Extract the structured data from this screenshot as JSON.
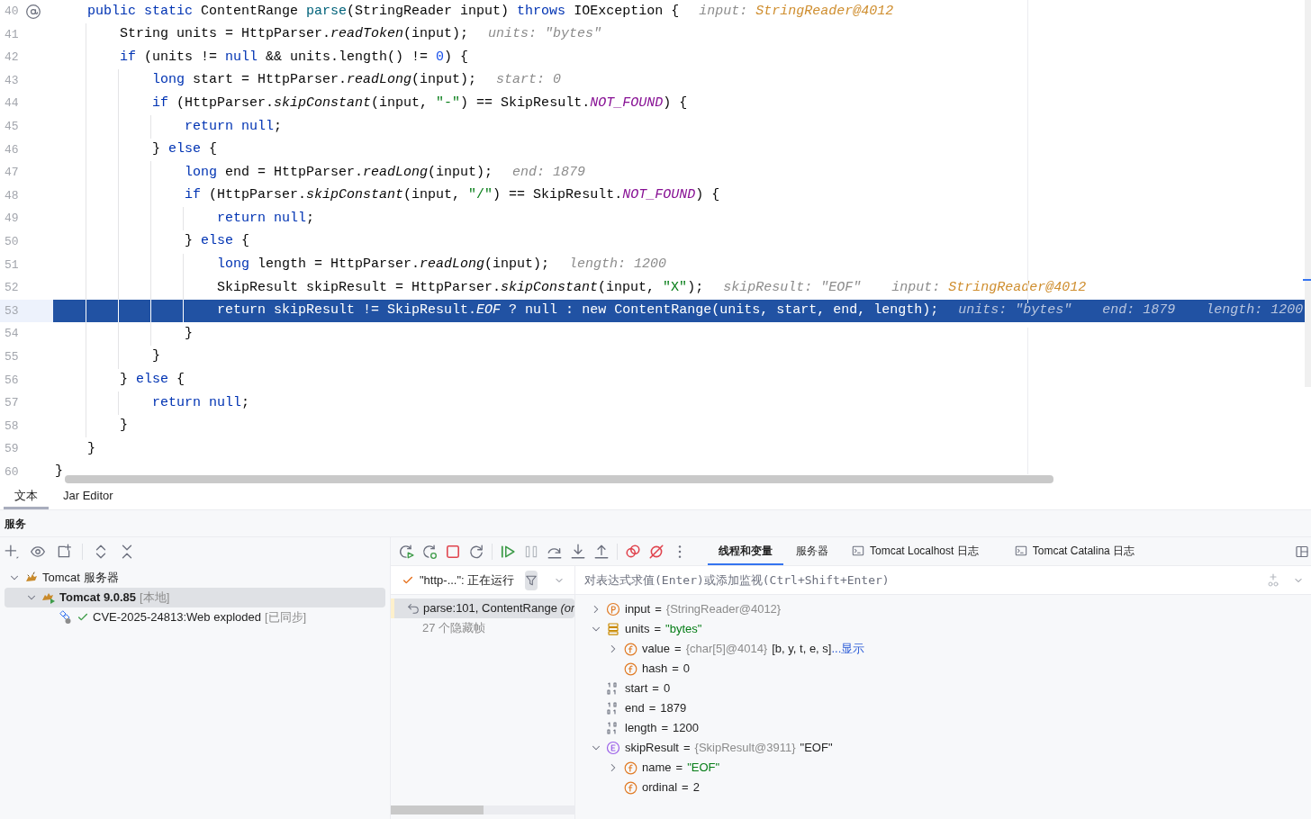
{
  "editor": {
    "lines": [
      {
        "number": "40",
        "marker": true,
        "selected": false,
        "tokens": [
          {
            "t": "    public static ",
            "kind": "kw"
          },
          {
            "t": "ContentRange ",
            "kind": "plain"
          },
          {
            "t": "parse",
            "kind": "decl"
          },
          {
            "t": "(StringReader input) ",
            "kind": "plain"
          },
          {
            "t": "throws ",
            "kind": "kw"
          },
          {
            "t": "IOException {",
            "kind": "plain"
          }
        ],
        "hints": [
          {
            "label": "input:",
            "value": "StringReader@4012",
            "kind": "ref"
          }
        ]
      },
      {
        "number": "41",
        "selected": false,
        "tokens": [
          {
            "t": "        String units = HttpParser.",
            "kind": "plain"
          },
          {
            "t": "readToken",
            "kind": "call"
          },
          {
            "t": "(input);",
            "kind": "plain"
          }
        ],
        "hints": [
          {
            "label": "units:",
            "value": "\"bytes\"",
            "kind": "plain"
          }
        ]
      },
      {
        "number": "42",
        "selected": false,
        "tokens": [
          {
            "t": "        if ",
            "kind": "kw"
          },
          {
            "t": "(units != ",
            "kind": "plain"
          },
          {
            "t": "null ",
            "kind": "kw"
          },
          {
            "t": "&& units.length() != ",
            "kind": "plain"
          },
          {
            "t": "0",
            "kind": "num"
          },
          {
            "t": ") {",
            "kind": "plain"
          }
        ]
      },
      {
        "number": "43",
        "selected": false,
        "tokens": [
          {
            "t": "            long ",
            "kind": "kw"
          },
          {
            "t": "start = HttpParser.",
            "kind": "plain"
          },
          {
            "t": "readLong",
            "kind": "call"
          },
          {
            "t": "(input);",
            "kind": "plain"
          }
        ],
        "hints": [
          {
            "label": "start:",
            "value": "0",
            "kind": "plain"
          }
        ]
      },
      {
        "number": "44",
        "selected": false,
        "tokens": [
          {
            "t": "            if ",
            "kind": "kw"
          },
          {
            "t": "(HttpParser.",
            "kind": "plain"
          },
          {
            "t": "skipConstant",
            "kind": "call"
          },
          {
            "t": "(input, ",
            "kind": "plain"
          },
          {
            "t": "\"-\"",
            "kind": "str"
          },
          {
            "t": ") == SkipResult.",
            "kind": "plain"
          },
          {
            "t": "NOT_FOUND",
            "kind": "const"
          },
          {
            "t": ") {",
            "kind": "plain"
          }
        ]
      },
      {
        "number": "45",
        "selected": false,
        "tokens": [
          {
            "t": "                return null",
            "kind": "kw"
          },
          {
            "t": ";",
            "kind": "plain"
          }
        ]
      },
      {
        "number": "46",
        "selected": false,
        "tokens": [
          {
            "t": "            } ",
            "kind": "plain"
          },
          {
            "t": "else ",
            "kind": "kw"
          },
          {
            "t": "{",
            "kind": "plain"
          }
        ]
      },
      {
        "number": "47",
        "selected": false,
        "tokens": [
          {
            "t": "                long ",
            "kind": "kw"
          },
          {
            "t": "end = HttpParser.",
            "kind": "plain"
          },
          {
            "t": "readLong",
            "kind": "call"
          },
          {
            "t": "(input);",
            "kind": "plain"
          }
        ],
        "hints": [
          {
            "label": "end:",
            "value": "1879",
            "kind": "plain"
          }
        ]
      },
      {
        "number": "48",
        "selected": false,
        "tokens": [
          {
            "t": "                if ",
            "kind": "kw"
          },
          {
            "t": "(HttpParser.",
            "kind": "plain"
          },
          {
            "t": "skipConstant",
            "kind": "call"
          },
          {
            "t": "(input, ",
            "kind": "plain"
          },
          {
            "t": "\"/\"",
            "kind": "str"
          },
          {
            "t": ") == SkipResult.",
            "kind": "plain"
          },
          {
            "t": "NOT_FOUND",
            "kind": "const"
          },
          {
            "t": ") {",
            "kind": "plain"
          }
        ]
      },
      {
        "number": "49",
        "selected": false,
        "tokens": [
          {
            "t": "                    return null",
            "kind": "kw"
          },
          {
            "t": ";",
            "kind": "plain"
          }
        ]
      },
      {
        "number": "50",
        "selected": false,
        "tokens": [
          {
            "t": "                } ",
            "kind": "plain"
          },
          {
            "t": "else ",
            "kind": "kw"
          },
          {
            "t": "{",
            "kind": "plain"
          }
        ]
      },
      {
        "number": "51",
        "selected": false,
        "tokens": [
          {
            "t": "                    long ",
            "kind": "kw"
          },
          {
            "t": "length = HttpParser.",
            "kind": "plain"
          },
          {
            "t": "readLong",
            "kind": "call"
          },
          {
            "t": "(input);",
            "kind": "plain"
          }
        ],
        "hints": [
          {
            "label": "length:",
            "value": "1200",
            "kind": "plain"
          }
        ]
      },
      {
        "number": "52",
        "selected": false,
        "tokens": [
          {
            "t": "                    SkipResult skipResult = HttpParser.",
            "kind": "plain"
          },
          {
            "t": "skipConstant",
            "kind": "call"
          },
          {
            "t": "(input, ",
            "kind": "plain"
          },
          {
            "t": "\"X\"",
            "kind": "str"
          },
          {
            "t": ");",
            "kind": "plain"
          }
        ],
        "hints": [
          {
            "label": "skipResult:",
            "value": "\"EOF\"",
            "kind": "plain"
          },
          {
            "label": "input:",
            "value": "StringReader@4012",
            "kind": "ref"
          }
        ]
      },
      {
        "number": "53",
        "selected": true,
        "tokens": [
          {
            "t": "                    return ",
            "kind": "kw"
          },
          {
            "t": "skipResult != SkipResult.",
            "kind": "plain"
          },
          {
            "t": "EOF",
            "kind": "const"
          },
          {
            "t": " ? ",
            "kind": "plain"
          },
          {
            "t": "null ",
            "kind": "kw"
          },
          {
            "t": ": ",
            "kind": "plain"
          },
          {
            "t": "new ",
            "kind": "kw"
          },
          {
            "t": "ContentRange(units, start, end, length);",
            "kind": "plain"
          }
        ],
        "hints": [
          {
            "label": "units:",
            "value": "\"bytes\"",
            "kind": "plain"
          },
          {
            "label": "end:",
            "value": "1879",
            "kind": "plain"
          },
          {
            "label": "length:",
            "value": "1200",
            "kind": "plain"
          }
        ]
      },
      {
        "number": "54",
        "selected": false,
        "tokens": [
          {
            "t": "                }",
            "kind": "plain"
          }
        ]
      },
      {
        "number": "55",
        "selected": false,
        "tokens": [
          {
            "t": "            }",
            "kind": "plain"
          }
        ]
      },
      {
        "number": "56",
        "selected": false,
        "tokens": [
          {
            "t": "        } ",
            "kind": "plain"
          },
          {
            "t": "else ",
            "kind": "kw"
          },
          {
            "t": "{",
            "kind": "plain"
          }
        ]
      },
      {
        "number": "57",
        "selected": false,
        "tokens": [
          {
            "t": "            return null",
            "kind": "kw"
          },
          {
            "t": ";",
            "kind": "plain"
          }
        ]
      },
      {
        "number": "58",
        "selected": false,
        "tokens": [
          {
            "t": "        }",
            "kind": "plain"
          }
        ]
      },
      {
        "number": "59",
        "selected": false,
        "tokens": [
          {
            "t": "    }",
            "kind": "plain"
          }
        ]
      },
      {
        "number": "60",
        "selected": false,
        "tokens": [
          {
            "t": "}",
            "kind": "plain"
          }
        ]
      }
    ]
  },
  "editor_tabs": [
    {
      "label": "文本",
      "selected": true
    },
    {
      "label": "Jar Editor",
      "selected": false
    }
  ],
  "services": {
    "title": "服务",
    "tree": [
      {
        "label": "Tomcat 服务器",
        "kind": "group",
        "expanded": true,
        "selected": false,
        "children": [
          {
            "label": "Tomcat 9.0.85",
            "note": "[本地]",
            "kind": "server",
            "expanded": true,
            "selected": true,
            "children": [
              {
                "label": "CVE-2025-24813:Web exploded",
                "note": "[已同步]",
                "kind": "artifact",
                "selected": false
              }
            ]
          }
        ]
      }
    ]
  },
  "debugger": {
    "tabs": [
      {
        "label": "线程和变量",
        "kind": "view",
        "selected": true
      },
      {
        "label": "服务器",
        "kind": "view",
        "selected": false
      },
      {
        "label": "Tomcat Localhost 日志",
        "kind": "log",
        "selected": false
      },
      {
        "label": "Tomcat Catalina 日志",
        "kind": "log",
        "selected": false
      }
    ],
    "thread": "\"http-...\": 正在运行",
    "frames": [
      {
        "label": "parse:101, ContentRange",
        "detail": "(or",
        "selected": true
      }
    ],
    "hidden_frames": "27 个隐藏帧",
    "eval_placeholder": "对表达式求值(Enter)或添加监视(Ctrl+Shift+Enter)",
    "variables": [
      {
        "name": "input",
        "sep": "=",
        "kind": "param",
        "expanded": false,
        "value": [
          {
            "t": "{StringReader@4012}",
            "kind": "ref"
          }
        ]
      },
      {
        "name": "units",
        "sep": "=",
        "kind": "object",
        "expanded": true,
        "value": [
          {
            "t": "\"bytes\"",
            "kind": "str"
          }
        ],
        "children": [
          {
            "name": "value",
            "sep": "=",
            "kind": "field",
            "expanded": false,
            "value": [
              {
                "t": "{char[5]@4014}",
                "kind": "ref"
              },
              {
                "t": "[b, y, t, e, s]",
                "kind": "plain"
              },
              {
                "t": "...显示",
                "kind": "link"
              }
            ]
          },
          {
            "name": "hash",
            "sep": "=",
            "kind": "field",
            "value": [
              {
                "t": "0",
                "kind": "plain"
              }
            ]
          }
        ]
      },
      {
        "name": "start",
        "sep": "=",
        "kind": "primitive",
        "value": [
          {
            "t": "0",
            "kind": "plain"
          }
        ]
      },
      {
        "name": "end",
        "sep": "=",
        "kind": "primitive",
        "value": [
          {
            "t": "1879",
            "kind": "plain"
          }
        ]
      },
      {
        "name": "length",
        "sep": "=",
        "kind": "primitive",
        "value": [
          {
            "t": "1200",
            "kind": "plain"
          }
        ]
      },
      {
        "name": "skipResult",
        "sep": "=",
        "kind": "enum",
        "expanded": true,
        "value": [
          {
            "t": "{SkipResult@3911}",
            "kind": "ref"
          },
          {
            "t": "\"EOF\"",
            "kind": "plain"
          }
        ],
        "children": [
          {
            "name": "name",
            "sep": "=",
            "kind": "field",
            "expanded": false,
            "value": [
              {
                "t": "\"EOF\"",
                "kind": "str"
              }
            ]
          },
          {
            "name": "ordinal",
            "sep": "=",
            "kind": "field",
            "value": [
              {
                "t": "2",
                "kind": "plain"
              }
            ]
          }
        ]
      }
    ]
  }
}
